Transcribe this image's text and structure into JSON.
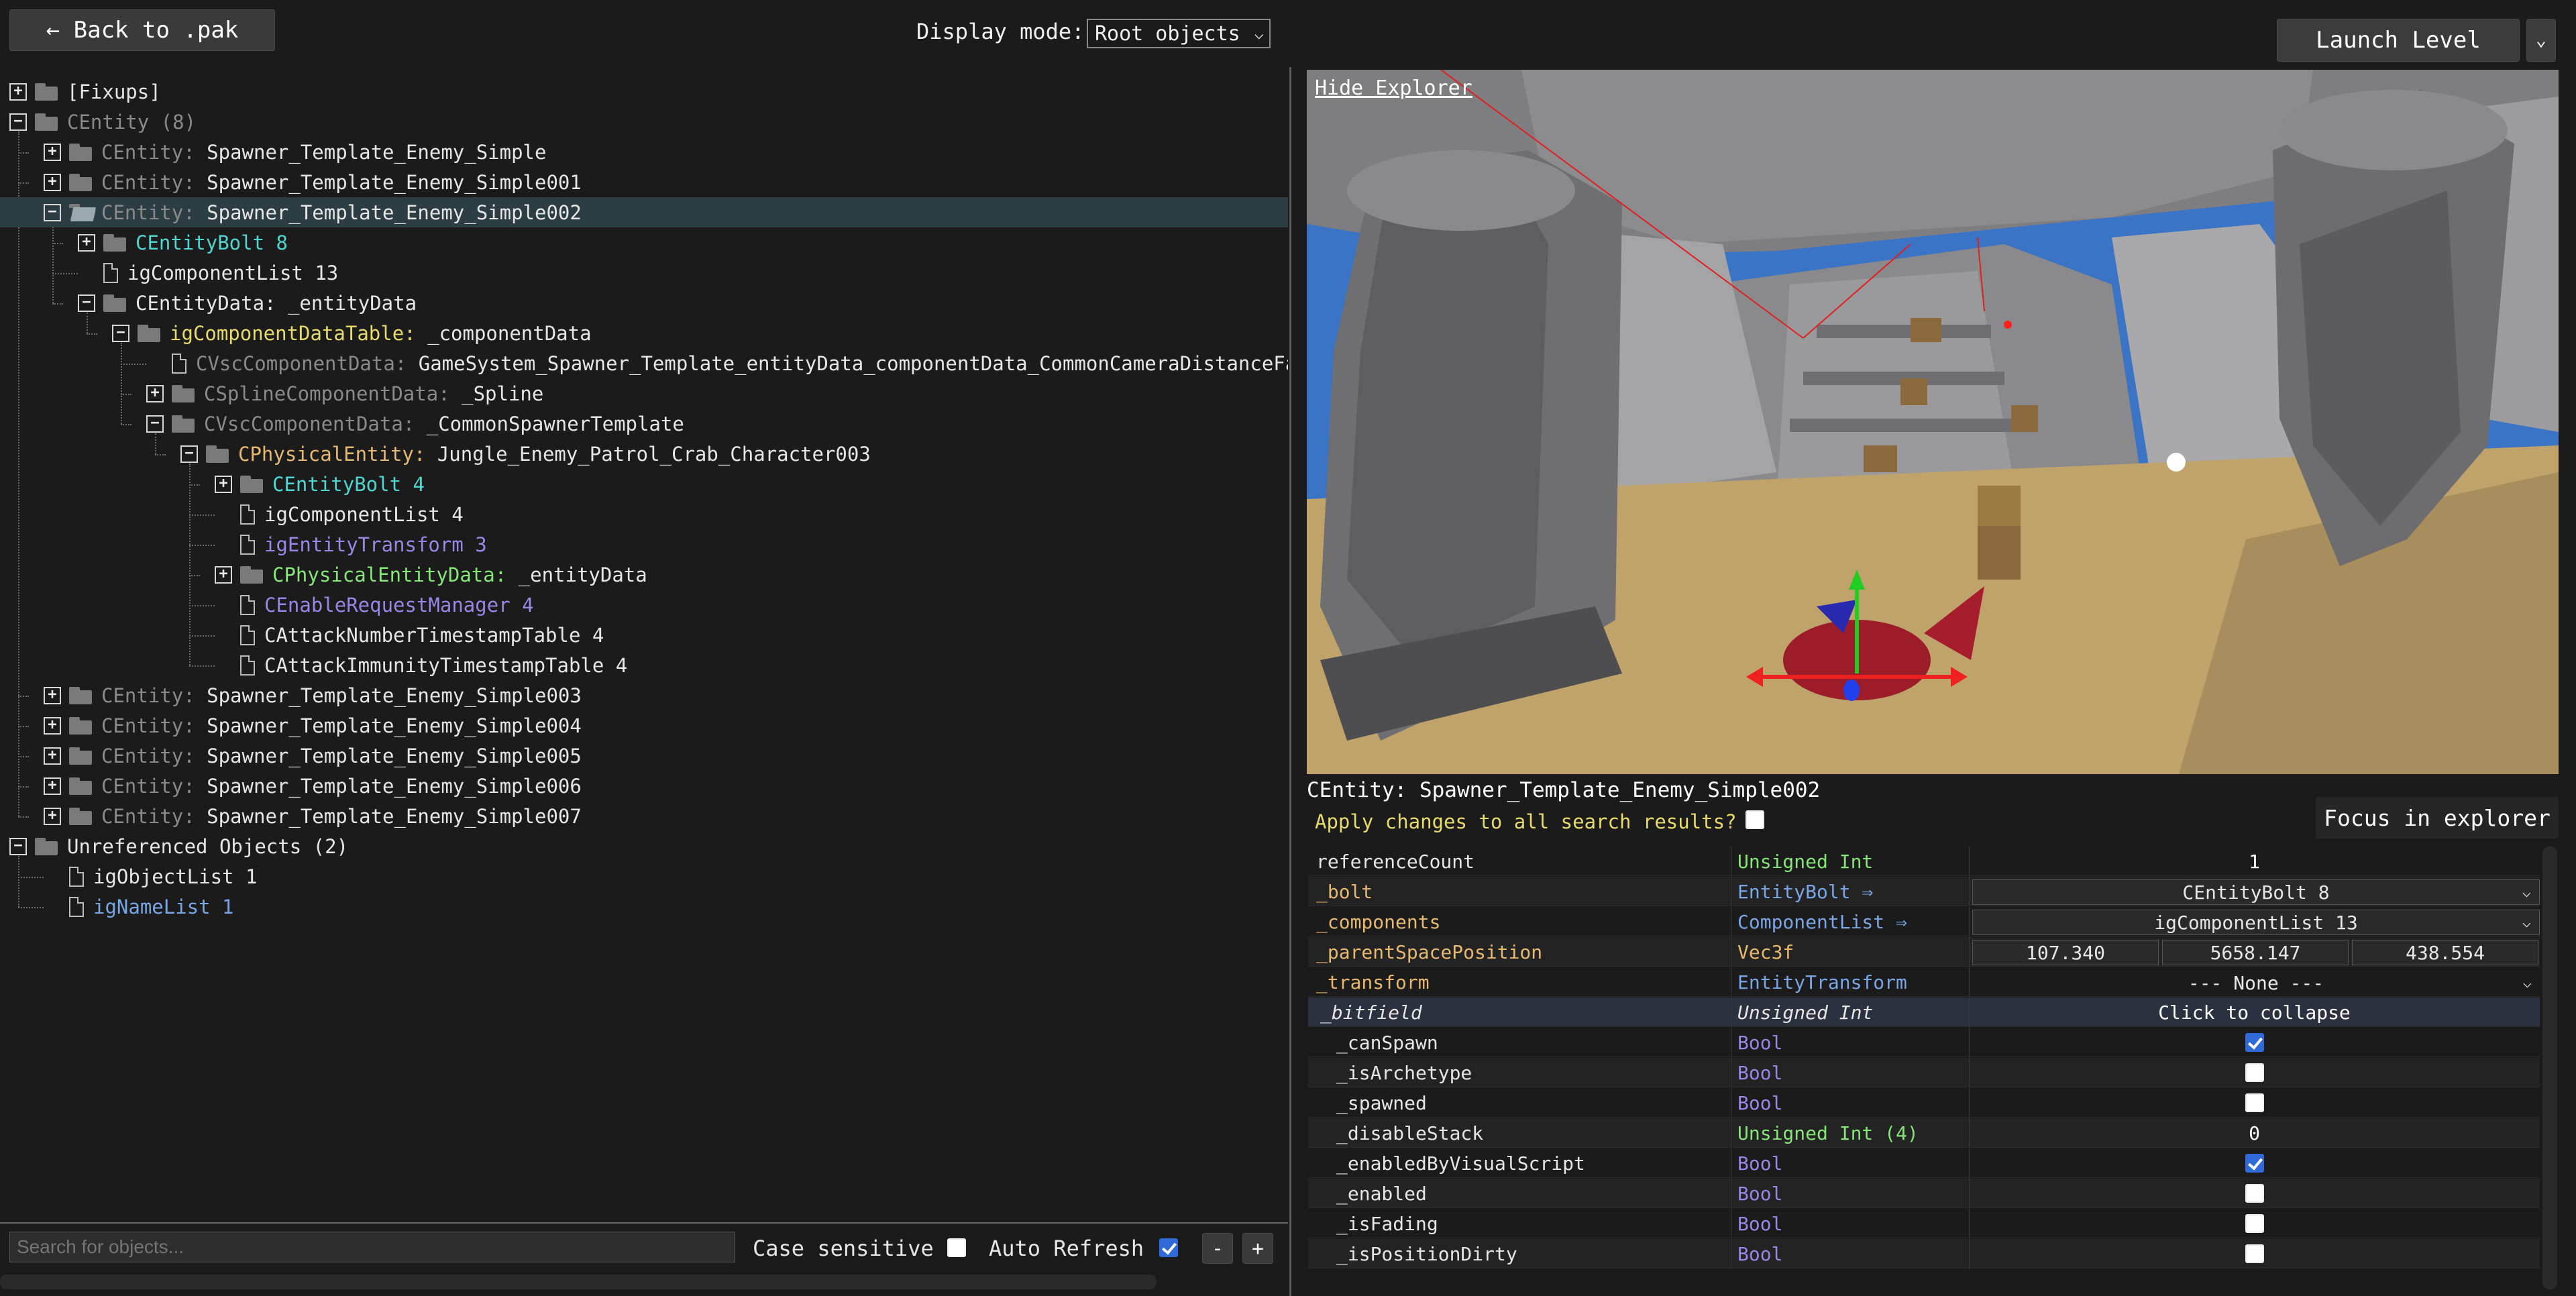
{
  "topbar": {
    "back_label": "← Back to .pak",
    "display_mode_label": "Display mode:",
    "display_mode_value": "Root objects",
    "launch_label": "Launch Level",
    "launch_dropdown": "⌄"
  },
  "tree": [
    {
      "depth": 0,
      "exp": "+",
      "icon": "folder",
      "parts": [
        [
          "[Fixups]",
          "white"
        ]
      ]
    },
    {
      "depth": 0,
      "exp": "-",
      "icon": "folder",
      "parts": [
        [
          "CEntity (8)",
          "grey"
        ]
      ]
    },
    {
      "depth": 1,
      "exp": "+",
      "icon": "folder",
      "parts": [
        [
          "CEntity: ",
          "grey"
        ],
        [
          "Spawner_Template_Enemy_Simple",
          "white"
        ]
      ]
    },
    {
      "depth": 1,
      "exp": "+",
      "icon": "folder",
      "parts": [
        [
          "CEntity: ",
          "grey"
        ],
        [
          "Spawner_Template_Enemy_Simple001",
          "white"
        ]
      ]
    },
    {
      "depth": 1,
      "exp": "-",
      "icon": "folder-open",
      "selected": true,
      "parts": [
        [
          "CEntity: ",
          "grey"
        ],
        [
          "Spawner_Template_Enemy_Simple002",
          "white"
        ]
      ]
    },
    {
      "depth": 2,
      "exp": "+",
      "icon": "folder",
      "parts": [
        [
          "CEntityBolt 8",
          "teal"
        ]
      ]
    },
    {
      "depth": 2,
      "exp": "",
      "icon": "file",
      "parts": [
        [
          "igComponentList 13",
          "white"
        ]
      ]
    },
    {
      "depth": 2,
      "exp": "-",
      "icon": "folder",
      "parts": [
        [
          "CEntityData: _entityData",
          "white"
        ]
      ]
    },
    {
      "depth": 3,
      "exp": "-",
      "icon": "folder",
      "parts": [
        [
          "igComponentDataTable: ",
          "yellow"
        ],
        [
          "_componentData",
          "white"
        ]
      ]
    },
    {
      "depth": 4,
      "exp": "",
      "icon": "file",
      "parts": [
        [
          "CVscComponentData: ",
          "grey"
        ],
        [
          "GameSystem_Spawner_Template_entityData_componentData_CommonCameraDistanceFa",
          "white"
        ]
      ]
    },
    {
      "depth": 4,
      "exp": "+",
      "icon": "folder",
      "parts": [
        [
          "CSplineComponentData: ",
          "grey"
        ],
        [
          "_Spline",
          "white"
        ]
      ]
    },
    {
      "depth": 4,
      "exp": "-",
      "icon": "folder",
      "parts": [
        [
          "CVscComponentData: ",
          "grey"
        ],
        [
          "_CommonSpawnerTemplate",
          "white"
        ]
      ]
    },
    {
      "depth": 5,
      "exp": "-",
      "icon": "folder",
      "parts": [
        [
          "CPhysicalEntity: ",
          "orange"
        ],
        [
          "Jungle_Enemy_Patrol_Crab_Character003",
          "white"
        ]
      ]
    },
    {
      "depth": 6,
      "exp": "+",
      "icon": "folder",
      "parts": [
        [
          "CEntityBolt 4",
          "teal"
        ]
      ]
    },
    {
      "depth": 6,
      "exp": "",
      "icon": "file",
      "parts": [
        [
          "igComponentList 4",
          "white"
        ]
      ]
    },
    {
      "depth": 6,
      "exp": "",
      "icon": "file",
      "parts": [
        [
          "igEntityTransform 3",
          "purple"
        ]
      ]
    },
    {
      "depth": 6,
      "exp": "+",
      "icon": "folder",
      "parts": [
        [
          "CPhysicalEntityData: ",
          "green"
        ],
        [
          "_entityData",
          "white"
        ]
      ]
    },
    {
      "depth": 6,
      "exp": "",
      "icon": "file",
      "parts": [
        [
          "CEnableRequestManager 4",
          "purple"
        ]
      ]
    },
    {
      "depth": 6,
      "exp": "",
      "icon": "file",
      "parts": [
        [
          "CAttackNumberTimestampTable 4",
          "white"
        ]
      ]
    },
    {
      "depth": 6,
      "exp": "",
      "icon": "file",
      "parts": [
        [
          "CAttackImmunityTimestampTable 4",
          "white"
        ]
      ]
    },
    {
      "depth": 1,
      "exp": "+",
      "icon": "folder",
      "parts": [
        [
          "CEntity: ",
          "grey"
        ],
        [
          "Spawner_Template_Enemy_Simple003",
          "white"
        ]
      ]
    },
    {
      "depth": 1,
      "exp": "+",
      "icon": "folder",
      "parts": [
        [
          "CEntity: ",
          "grey"
        ],
        [
          "Spawner_Template_Enemy_Simple004",
          "white"
        ]
      ]
    },
    {
      "depth": 1,
      "exp": "+",
      "icon": "folder",
      "parts": [
        [
          "CEntity: ",
          "grey"
        ],
        [
          "Spawner_Template_Enemy_Simple005",
          "white"
        ]
      ]
    },
    {
      "depth": 1,
      "exp": "+",
      "icon": "folder",
      "parts": [
        [
          "CEntity: ",
          "grey"
        ],
        [
          "Spawner_Template_Enemy_Simple006",
          "white"
        ]
      ]
    },
    {
      "depth": 1,
      "exp": "+",
      "icon": "folder",
      "parts": [
        [
          "CEntity: ",
          "grey"
        ],
        [
          "Spawner_Template_Enemy_Simple007",
          "white"
        ]
      ]
    },
    {
      "depth": 0,
      "exp": "-",
      "icon": "folder",
      "parts": [
        [
          "Unreferenced Objects (2)",
          "white"
        ]
      ]
    },
    {
      "depth": 1,
      "exp": "",
      "icon": "file",
      "parts": [
        [
          "igObjectList 1",
          "white"
        ]
      ]
    },
    {
      "depth": 1,
      "exp": "",
      "icon": "file",
      "parts": [
        [
          "igNameList 1",
          "blue"
        ]
      ]
    }
  ],
  "bottom": {
    "search_placeholder": "Search for objects...",
    "case_sensitive_label": "Case sensitive",
    "case_sensitive_checked": false,
    "auto_refresh_label": "Auto Refresh",
    "auto_refresh_checked": true,
    "minus_label": "-",
    "plus_label": "+"
  },
  "viewport": {
    "hide_explorer_label": "Hide Explorer"
  },
  "inspector": {
    "title": "CEntity: Spawner_Template_Enemy_Simple002",
    "apply_label": "Apply changes to all search results?",
    "apply_checked": false,
    "focus_label": "Focus in explorer",
    "rows": [
      {
        "name": "referenceCount",
        "name_color": "white",
        "type": "Unsigned Int",
        "type_color": "green",
        "kind": "text",
        "value": "1"
      },
      {
        "name": "_bolt",
        "name_color": "orange",
        "type": "EntityBolt ⇒",
        "type_color": "blue",
        "kind": "select",
        "value": "CEntityBolt 8"
      },
      {
        "name": "_components",
        "name_color": "orange",
        "type": "ComponentList ⇒",
        "type_color": "blue",
        "kind": "select",
        "value": "igComponentList 13"
      },
      {
        "name": "_parentSpacePosition",
        "name_color": "orange",
        "type": "Vec3f",
        "type_color": "orange",
        "kind": "vec3",
        "values": [
          "107.340",
          "5658.147",
          "438.554"
        ]
      },
      {
        "name": "_transform",
        "name_color": "orange",
        "type": "EntityTransform",
        "type_color": "blue",
        "kind": "select-flat",
        "value": "--- None ---"
      },
      {
        "name": "_bitfield",
        "name_color": "white",
        "type": "Unsigned Int",
        "type_color": "white",
        "kind": "header",
        "value": "Click to collapse"
      },
      {
        "name": "_canSpawn",
        "name_color": "white",
        "type": "Bool",
        "type_color": "purple",
        "kind": "check",
        "checked": true
      },
      {
        "name": "_isArchetype",
        "name_color": "white",
        "type": "Bool",
        "type_color": "purple",
        "kind": "check",
        "checked": false
      },
      {
        "name": "_spawned",
        "name_color": "white",
        "type": "Bool",
        "type_color": "purple",
        "kind": "check",
        "checked": false
      },
      {
        "name": "_disableStack",
        "name_color": "white",
        "type": "Unsigned Int (4)",
        "type_color": "green",
        "kind": "text",
        "value": "0"
      },
      {
        "name": "_enabledByVisualScript",
        "name_color": "white",
        "type": "Bool",
        "type_color": "purple",
        "kind": "check",
        "checked": true
      },
      {
        "name": "_enabled",
        "name_color": "white",
        "type": "Bool",
        "type_color": "purple",
        "kind": "check",
        "checked": false
      },
      {
        "name": "_isFading",
        "name_color": "white",
        "type": "Bool",
        "type_color": "purple",
        "kind": "check",
        "checked": false
      },
      {
        "name": "_isPositionDirty",
        "name_color": "white",
        "type": "Bool",
        "type_color": "purple",
        "kind": "check",
        "checked": false
      }
    ]
  },
  "colors": {
    "white": "#e6e6e6",
    "grey": "#8a8a8a",
    "teal": "#4fd6d0",
    "yellow": "#e7dc6a",
    "purple": "#9b86e6",
    "orange": "#e6b870",
    "green": "#86e678",
    "blue": "#7aa6e6"
  }
}
